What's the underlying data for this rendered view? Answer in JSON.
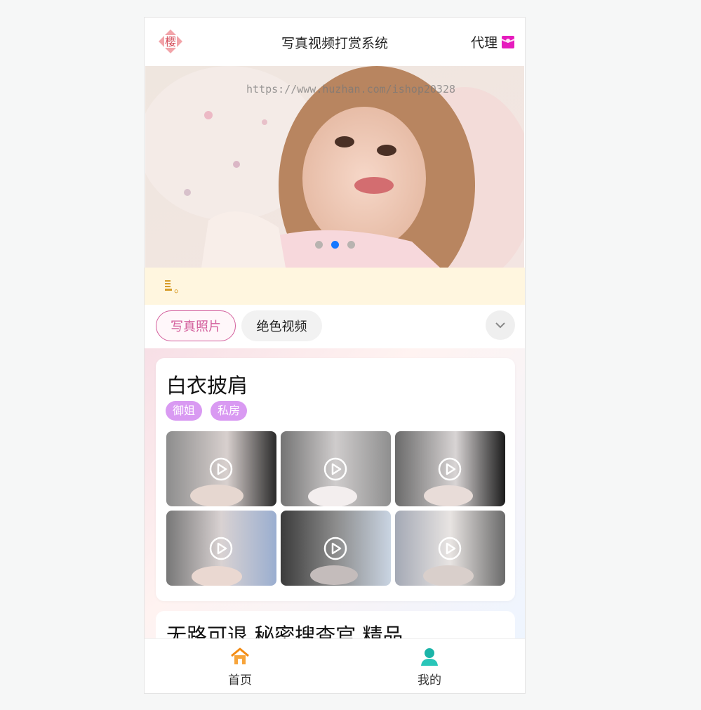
{
  "header": {
    "logo_char": "樱",
    "title": "写真视频打赏系统",
    "agent_label": "代理"
  },
  "banner": {
    "watermark": "https://www.huzhan.com/ishop20328",
    "active_dot_index": 1,
    "dot_count": 3
  },
  "notice": {
    "text": "。"
  },
  "tabs": [
    {
      "label": "写真照片",
      "active": true
    },
    {
      "label": "绝色视频",
      "active": false
    }
  ],
  "cards": [
    {
      "title": "白衣披肩",
      "tags": [
        "御姐",
        "私房"
      ]
    },
    {
      "title": "无路可退 秘密搜查官 精品"
    }
  ],
  "bottom_nav": {
    "home_label": "首页",
    "mine_label": "我的"
  },
  "colors": {
    "accent_pink": "#d35f9c",
    "tag_purple": "#d99af2",
    "notice_bg": "#fff6df",
    "dot_active": "#1677ff",
    "home_orange": "#f38b13",
    "mine_teal": "#22b9b2"
  },
  "icons": {
    "logo": "sakura-logo-icon",
    "agent": "red-envelope-icon",
    "notice": "notice-icon",
    "expand": "chevron-down-icon",
    "play": "play-icon",
    "home": "home-icon",
    "mine": "user-icon"
  }
}
